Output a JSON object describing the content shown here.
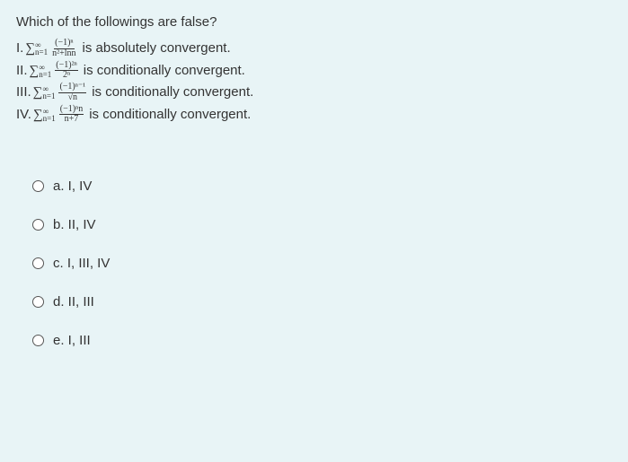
{
  "question": "Which of the followings are false?",
  "statements": [
    {
      "roman": "I.",
      "sum_l": "∞",
      "sum_s": "n=1",
      "num": "(−1)ⁿ",
      "den": "n²+lnn",
      "desc": "is absolutely convergent."
    },
    {
      "roman": "II.",
      "sum_l": "∞",
      "sum_s": "n=1",
      "num": "(−1)²ⁿ",
      "den": "2ⁿ",
      "desc": "is conditionally convergent."
    },
    {
      "roman": "III.",
      "sum_l": "∞",
      "sum_s": "n=1",
      "num": "(−1)ⁿ⁻¹",
      "den": "√n",
      "desc": "is conditionally convergent."
    },
    {
      "roman": "IV.",
      "sum_l": "∞",
      "sum_s": "n=1",
      "num": "(−1)ⁿn",
      "den": "n+7",
      "desc": "is conditionally convergent."
    }
  ],
  "options": {
    "a": "a. I, IV",
    "b": "b. II, IV",
    "c": "c. I, III, IV",
    "d": "d. II, III",
    "e": "e. I, III"
  }
}
